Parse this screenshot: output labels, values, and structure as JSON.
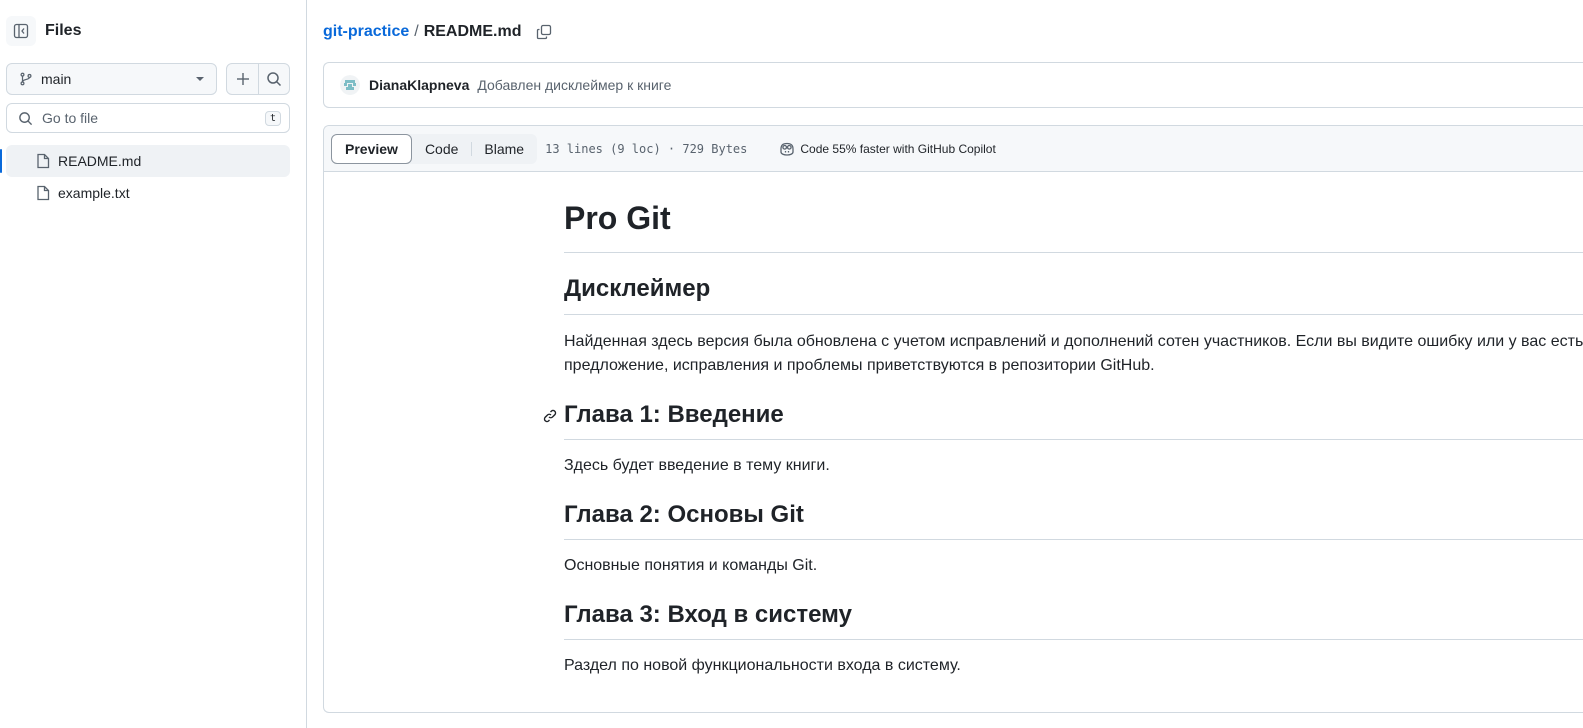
{
  "sidebar": {
    "title": "Files",
    "branch": "main",
    "search_placeholder": "Go to file",
    "search_shortcut": "t",
    "files": [
      {
        "name": "README.md",
        "active": true
      },
      {
        "name": "example.txt",
        "active": false
      }
    ]
  },
  "breadcrumb": {
    "repo": "git-practice",
    "separator": "/",
    "file": "README.md"
  },
  "commit": {
    "author": "DianaKlapneva",
    "message": "Добавлен дисклеймер к книге"
  },
  "file_header": {
    "tabs": [
      "Preview",
      "Code",
      "Blame"
    ],
    "selected_tab": "Preview",
    "meta": "13 lines (9 loc) · 729 Bytes",
    "copilot": "Code 55% faster with GitHub Copilot"
  },
  "readme": {
    "h1": "Pro Git",
    "disclaimer_heading": "Дисклеймер",
    "disclaimer_text": "Найденная здесь версия была обновлена с учетом исправлений и дополнений сотен участников. Если вы видите ошибку или у вас есть предложение, исправления и проблемы приветствуются в репозитории GitHub.",
    "ch1_heading": "Глава 1: Введение",
    "ch1_text": "Здесь будет введение в тему книги.",
    "ch2_heading": "Глава 2: Основы Git",
    "ch2_text": "Основные понятия и команды Git.",
    "ch3_heading": "Глава 3: Вход в систему",
    "ch3_text": "Раздел по новой функциональности входа в систему."
  },
  "colors": {
    "link": "#0969da",
    "border": "#d1d9e0",
    "muted": "#59636e",
    "header_bg": "#f6f8fa"
  }
}
